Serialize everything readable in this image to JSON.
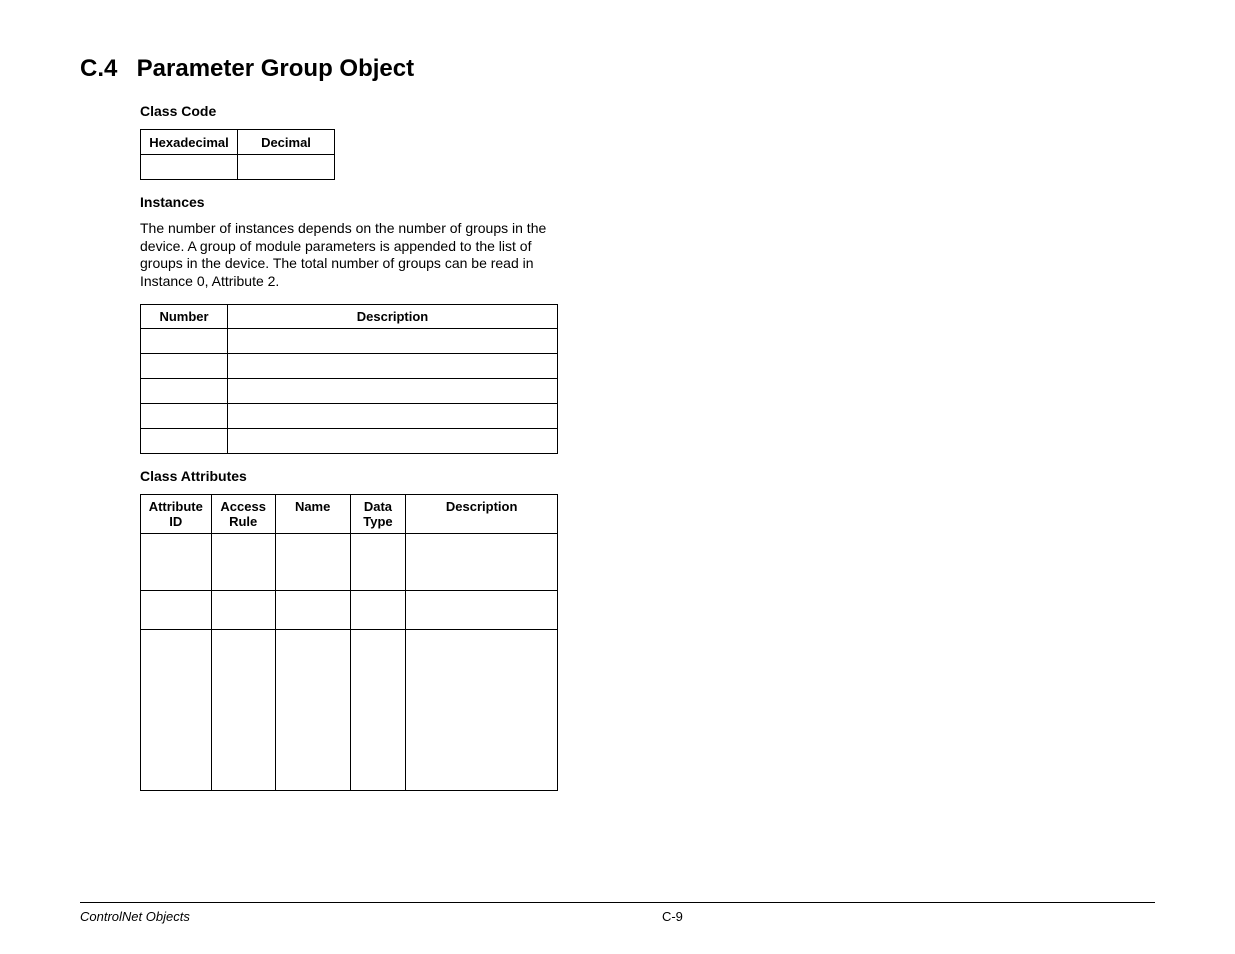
{
  "heading": {
    "number": "C.4",
    "title": "Parameter Group Object"
  },
  "classCode": {
    "label": "Class Code",
    "headers": [
      "Hexadecimal",
      "Decimal"
    ],
    "values": [
      "",
      ""
    ]
  },
  "instances": {
    "label": "Instances",
    "text": "The number of instances depends on the number of groups in the device. A group of module parameters is appended to the list of groups in the device. The total number of groups can be read in Instance 0, Attribute 2.",
    "headers": [
      "Number",
      "Description"
    ],
    "rows": [
      [
        "",
        ""
      ],
      [
        "",
        ""
      ],
      [
        "",
        ""
      ],
      [
        "",
        ""
      ],
      [
        "",
        ""
      ]
    ]
  },
  "classAttributes": {
    "label": "Class Attributes",
    "headers": {
      "attid": "Attribute ID",
      "access": "Access Rule",
      "name": "Name",
      "dtype": "Data Type",
      "desc": "Description"
    }
  },
  "footer": {
    "left": "ControlNet Objects",
    "center": "C-9"
  }
}
